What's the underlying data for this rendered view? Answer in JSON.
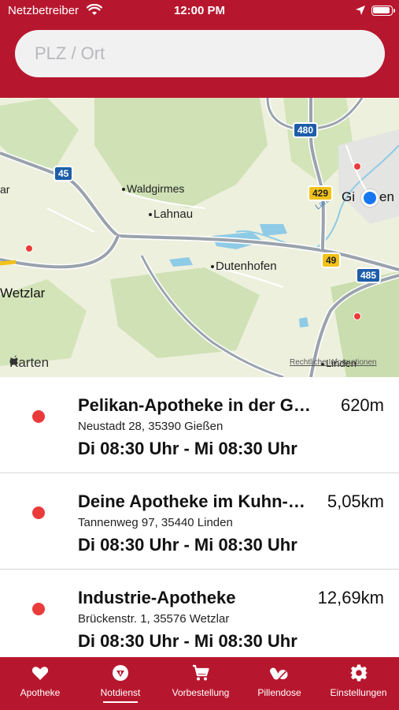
{
  "status_bar": {
    "carrier": "Netzbetreiber",
    "time": "12:00 PM"
  },
  "search": {
    "placeholder": "PLZ / Ort",
    "value": ""
  },
  "map": {
    "labels": {
      "waldgirmes": "Waldgirmes",
      "lahnau": "Lahnau",
      "dutenhofen": "Dutenhofen",
      "wetzlar": "Wetzlar",
      "giessen": "Gi",
      "giessen_tail": "en",
      "linden": "Linden",
      "edge_left": "ar",
      "river": "Lahn"
    },
    "shields": {
      "a45": "45",
      "a480": "480",
      "b429": "429",
      "b49": "49",
      "a485": "485"
    },
    "attribution": "Karten",
    "legal": "Rechtliche Informationen"
  },
  "pharmacies": [
    {
      "name": "Pelikan-Apotheke in der G…",
      "address": "Neustadt 28, 35390 Gießen",
      "hours": "Di 08:30 Uhr - Mi 08:30 Uhr",
      "distance": "620m"
    },
    {
      "name": "Deine Apotheke im Kuhn-…",
      "address": "Tannenweg 97, 35440 Linden",
      "hours": "Di 08:30 Uhr - Mi 08:30 Uhr",
      "distance": "5,05km"
    },
    {
      "name": "Industrie-Apotheke",
      "address": "Brückenstr. 1, 35576 Wetzlar",
      "hours": "Di 08:30 Uhr - Mi 08:30 Uhr",
      "distance": "12,69km"
    }
  ],
  "tabs": [
    {
      "label": "Apotheke",
      "icon": "heart-icon"
    },
    {
      "label": "Notdienst",
      "icon": "pharmacy-emergency-icon",
      "selected": true
    },
    {
      "label": "Vorbestellung",
      "icon": "cart-icon"
    },
    {
      "label": "Pillendose",
      "icon": "pills-icon"
    },
    {
      "label": "Einstellungen",
      "icon": "gear-icon"
    }
  ],
  "colors": {
    "brand": "#b7172e",
    "marker": "#ea3b3b",
    "user_location": "#1776f0"
  }
}
